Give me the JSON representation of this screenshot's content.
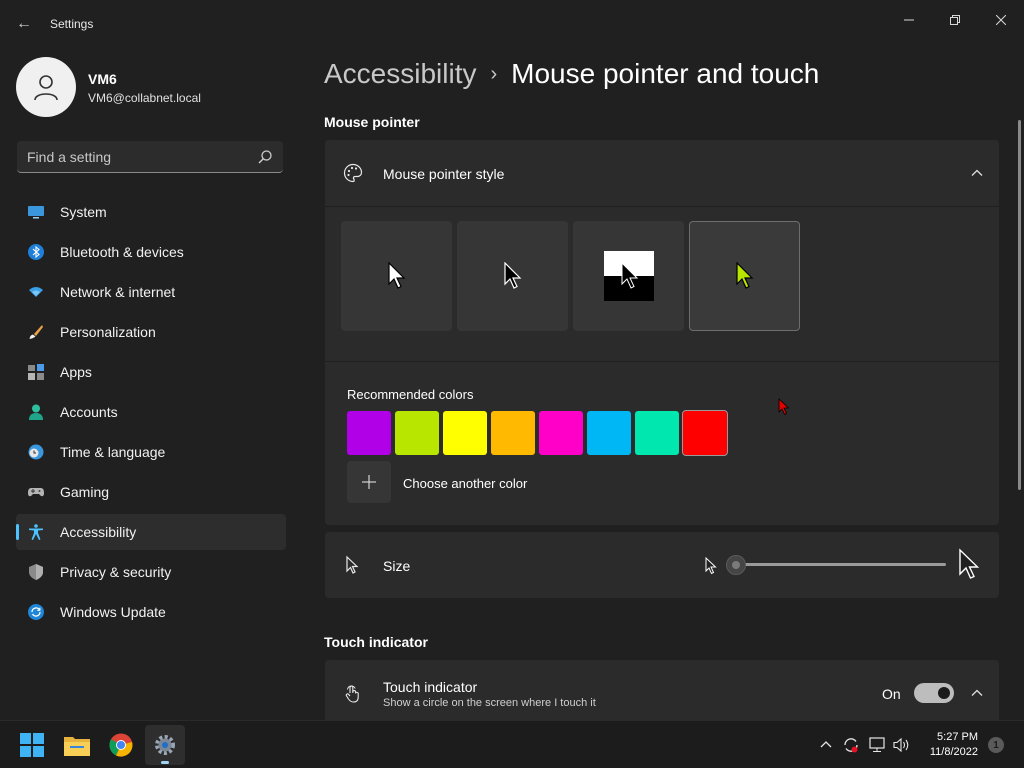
{
  "window": {
    "title": "Settings",
    "back_icon": "arrow-left-icon",
    "controls": [
      "minimize-icon",
      "restore-icon",
      "close-icon"
    ]
  },
  "profile": {
    "name": "VM6",
    "email": "VM6@collabnet.local"
  },
  "search": {
    "placeholder": "Find a setting",
    "value": ""
  },
  "sidebar": {
    "items": [
      {
        "label": "System",
        "icon": "monitor-icon",
        "active": false
      },
      {
        "label": "Bluetooth & devices",
        "icon": "bluetooth-icon",
        "active": false
      },
      {
        "label": "Network & internet",
        "icon": "wifi-icon",
        "active": false
      },
      {
        "label": "Personalization",
        "icon": "brush-icon",
        "active": false
      },
      {
        "label": "Apps",
        "icon": "apps-icon",
        "active": false
      },
      {
        "label": "Accounts",
        "icon": "person-icon",
        "active": false
      },
      {
        "label": "Time & language",
        "icon": "globe-clock-icon",
        "active": false
      },
      {
        "label": "Gaming",
        "icon": "gamepad-icon",
        "active": false
      },
      {
        "label": "Accessibility",
        "icon": "accessibility-icon",
        "active": true
      },
      {
        "label": "Privacy & security",
        "icon": "shield-icon",
        "active": false
      },
      {
        "label": "Windows Update",
        "icon": "update-icon",
        "active": false
      }
    ]
  },
  "breadcrumb": {
    "parent": "Accessibility",
    "separator": "›",
    "current": "Mouse pointer and touch"
  },
  "mouse_pointer": {
    "section_title": "Mouse pointer",
    "style_label": "Mouse pointer style",
    "styles": [
      {
        "name": "white",
        "selected": false
      },
      {
        "name": "black",
        "selected": false
      },
      {
        "name": "inverted",
        "selected": false
      },
      {
        "name": "custom",
        "selected": true,
        "color": "#b8e600"
      }
    ],
    "recommended_label": "Recommended colors",
    "colors": [
      "#b100e8",
      "#b8e600",
      "#ffff00",
      "#ffb900",
      "#ff00c8",
      "#00b7f5",
      "#00e8b0",
      "#ff0000"
    ],
    "selected_color_index": 7,
    "choose_another_label": "Choose another color",
    "size_label": "Size",
    "size_value": 0
  },
  "touch": {
    "section_title": "Touch indicator",
    "label": "Touch indicator",
    "description": "Show a circle on the screen where I touch it",
    "toggle_label": "On",
    "toggle_on": true
  },
  "taskbar": {
    "apps": [
      "start-icon",
      "file-explorer-icon",
      "chrome-icon",
      "settings-icon"
    ],
    "time": "5:27 PM",
    "date": "11/8/2022",
    "notifications": "1"
  }
}
